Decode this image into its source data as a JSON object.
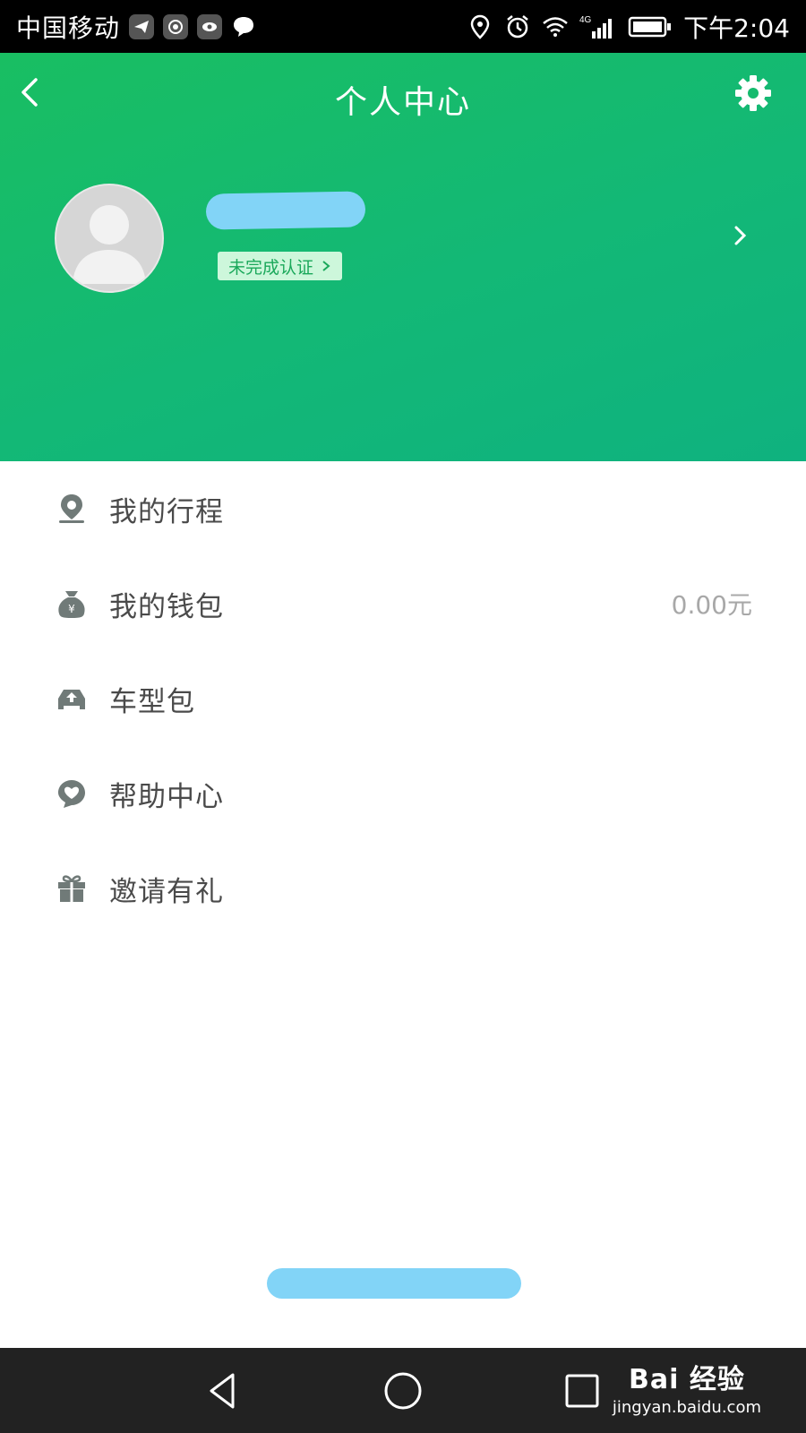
{
  "status_bar": {
    "carrier": "中国移动",
    "network": "4G",
    "time": "下午2:04"
  },
  "header": {
    "title": "个人中心",
    "auth_badge": "未完成认证",
    "accent_color": "#19be62"
  },
  "menu": {
    "items": [
      {
        "label": "我的行程",
        "icon": "location-pin-icon"
      },
      {
        "label": "我的钱包",
        "icon": "money-bag-icon",
        "value": "0.00元"
      },
      {
        "label": "车型包",
        "icon": "car-package-icon"
      },
      {
        "label": "帮助中心",
        "icon": "help-heart-icon"
      },
      {
        "label": "邀请有礼",
        "icon": "gift-icon"
      }
    ]
  },
  "watermark": {
    "main": "Bai 经验",
    "sub": "jingyan.baidu.com"
  }
}
